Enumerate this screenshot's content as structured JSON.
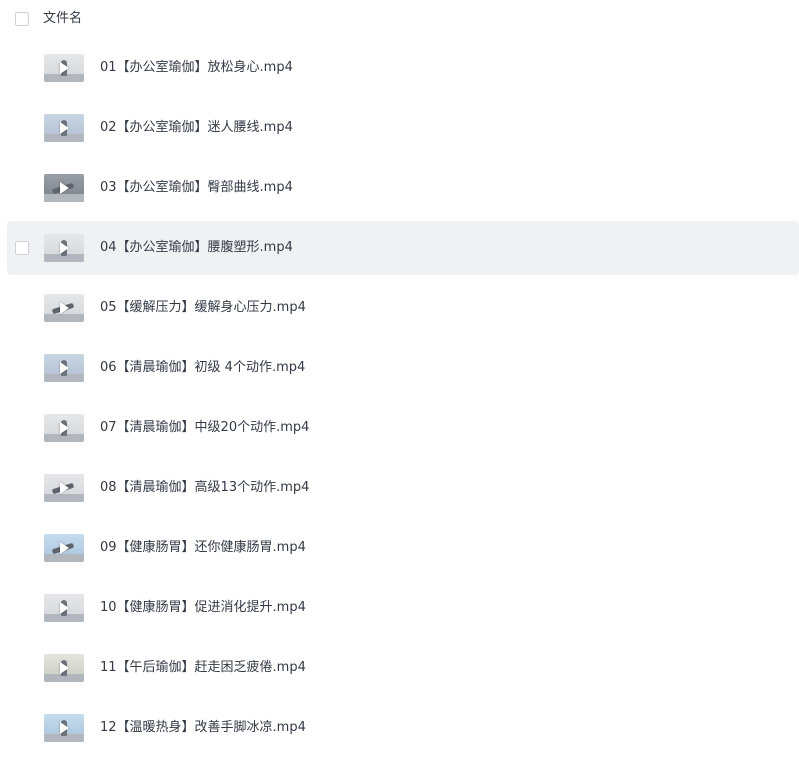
{
  "header": {
    "column_label": "文件名"
  },
  "files": [
    {
      "name": "01【办公室瑜伽】放松身心.mp4",
      "thumb": "t-light",
      "pose": "standing"
    },
    {
      "name": "02【办公室瑜伽】迷人腰线.mp4",
      "thumb": "t-blue",
      "pose": "standing"
    },
    {
      "name": "03【办公室瑜伽】臀部曲线.mp4",
      "thumb": "t-dark",
      "pose": "lunge"
    },
    {
      "name": "04【办公室瑜伽】腰腹塑形.mp4",
      "thumb": "t-light",
      "pose": "standing",
      "hovered": true
    },
    {
      "name": "05【缓解压力】缓解身心压力.mp4",
      "thumb": "t-light",
      "pose": "lunge"
    },
    {
      "name": "06【清晨瑜伽】初级 4个动作.mp4",
      "thumb": "t-blue",
      "pose": "standing"
    },
    {
      "name": "07【清晨瑜伽】中级20个动作.mp4",
      "thumb": "t-light",
      "pose": "seated"
    },
    {
      "name": "08【清晨瑜伽】高级13个动作.mp4",
      "thumb": "t-light",
      "pose": "lunge"
    },
    {
      "name": "09【健康肠胃】还你健康肠胃.mp4",
      "thumb": "t-sky",
      "pose": "lunge"
    },
    {
      "name": "10【健康肠胃】促进消化提升.mp4",
      "thumb": "t-light",
      "pose": "standing"
    },
    {
      "name": "11【午后瑜伽】赶走困乏疲倦.mp4",
      "thumb": "t-cream",
      "pose": "seated"
    },
    {
      "name": "12【温暖热身】改善手脚冰凉.mp4",
      "thumb": "t-sky",
      "pose": "seated"
    }
  ]
}
